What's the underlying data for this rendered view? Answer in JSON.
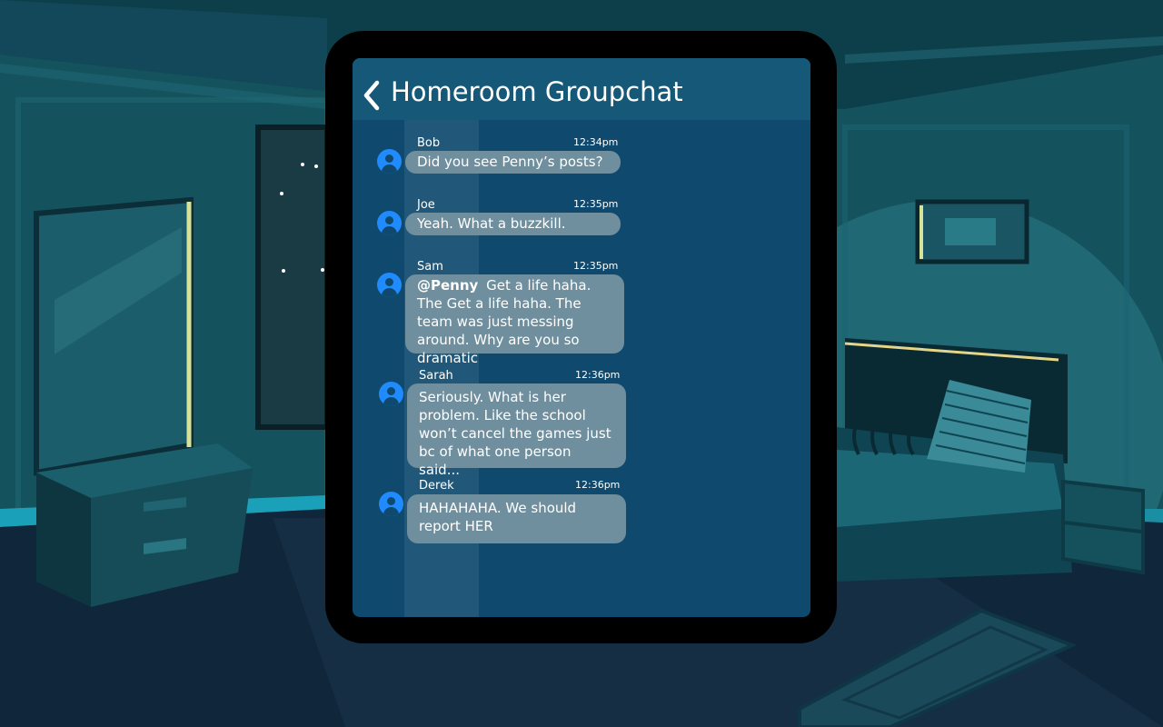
{
  "chat": {
    "title": "Homeroom Groupchat",
    "back_icon": "chevron-left-icon"
  },
  "messages": [
    {
      "sender": "Bob",
      "time": "12:34pm",
      "text": "Did you see Penny’s posts?"
    },
    {
      "sender": "Joe",
      "time": "12:35pm",
      "text": "Yeah. What a buzzkill."
    },
    {
      "sender": "Sam",
      "time": "12:35pm",
      "mention": "@Penny",
      "text": "Get a life haha. The Get a life haha. The team was just messing around. Why are you so dramatic"
    },
    {
      "sender": "Sarah",
      "time": "12:36pm",
      "text": "Seriously. What is her problem. Like the school won’t cancel the games just bc of what one person said..."
    },
    {
      "sender": "Derek",
      "time": "12:36pm",
      "text": "HAHAHAHA. We should report HER"
    }
  ],
  "colors": {
    "screen": "#0f4a6e",
    "header": "#155878",
    "bubble": "#6f8f9e",
    "avatar": "#1f8bff"
  }
}
